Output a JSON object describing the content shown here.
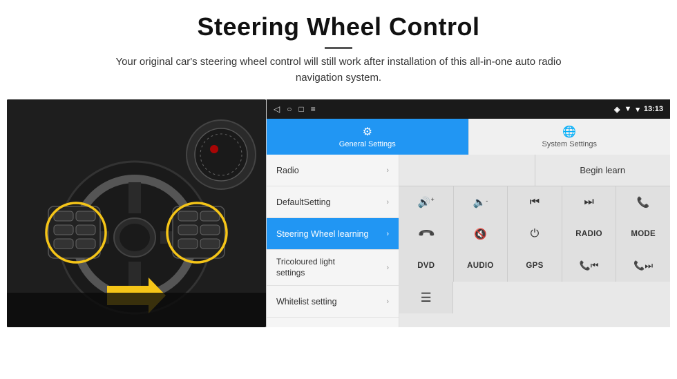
{
  "header": {
    "title": "Steering Wheel Control",
    "subtitle": "Your original car's steering wheel control will still work after installation of this all-in-one auto radio navigation system."
  },
  "status_bar": {
    "back_icon": "◁",
    "circle_icon": "○",
    "square_icon": "□",
    "menu_icon": "≡",
    "signal_icon": "▼",
    "wifi_icon": "▾",
    "time": "13:13"
  },
  "tabs": [
    {
      "id": "general",
      "label": "General Settings",
      "icon": "⚙",
      "active": true
    },
    {
      "id": "system",
      "label": "System Settings",
      "icon": "🌐",
      "active": false
    }
  ],
  "menu_items": [
    {
      "id": "radio",
      "label": "Radio",
      "active": false
    },
    {
      "id": "default",
      "label": "DefaultSetting",
      "active": false
    },
    {
      "id": "steering",
      "label": "Steering Wheel learning",
      "active": true
    },
    {
      "id": "tricoloured",
      "label": "Tricoloured light settings",
      "active": false
    },
    {
      "id": "whitelist",
      "label": "Whitelist setting",
      "active": false
    }
  ],
  "controls": {
    "begin_learn_label": "Begin learn",
    "buttons_row1": [
      {
        "id": "vol_up",
        "content": "🔊+",
        "type": "icon"
      },
      {
        "id": "vol_down",
        "content": "🔈-",
        "type": "icon"
      },
      {
        "id": "prev_track",
        "content": "⏮",
        "type": "icon"
      },
      {
        "id": "next_track",
        "content": "⏭",
        "type": "icon"
      },
      {
        "id": "phone",
        "content": "📞",
        "type": "icon"
      }
    ],
    "buttons_row2": [
      {
        "id": "hang_up",
        "content": "↩",
        "type": "icon"
      },
      {
        "id": "mute",
        "content": "🔇",
        "type": "icon"
      },
      {
        "id": "power",
        "content": "⏻",
        "type": "icon"
      },
      {
        "id": "radio_btn",
        "content": "RADIO",
        "type": "text"
      },
      {
        "id": "mode",
        "content": "MODE",
        "type": "text"
      }
    ],
    "buttons_row3": [
      {
        "id": "dvd",
        "content": "DVD",
        "type": "text"
      },
      {
        "id": "audio",
        "content": "AUDIO",
        "type": "text"
      },
      {
        "id": "gps",
        "content": "GPS",
        "type": "text"
      },
      {
        "id": "tel_prev",
        "content": "📞⏮",
        "type": "icon"
      },
      {
        "id": "tel_next",
        "content": "📞⏭",
        "type": "icon"
      }
    ],
    "buttons_row4": [
      {
        "id": "list",
        "content": "☰",
        "type": "icon"
      }
    ]
  }
}
